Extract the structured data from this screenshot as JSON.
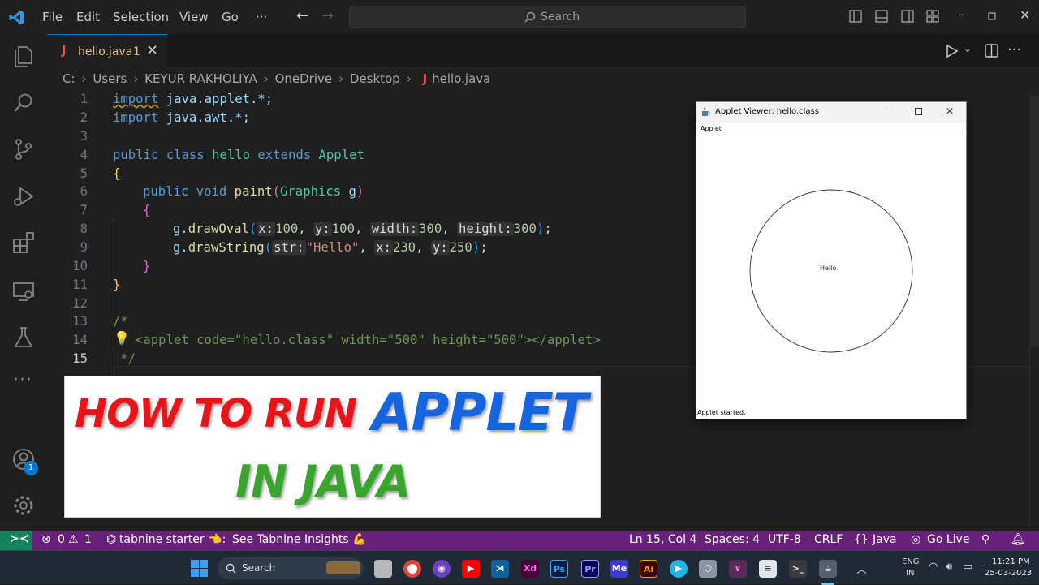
{
  "menu": [
    "File",
    "Edit",
    "Selection",
    "View",
    "Go",
    "···"
  ],
  "search": {
    "label": "Search"
  },
  "tab": {
    "name": "hello.java",
    "problems": "1"
  },
  "breadcrumb": [
    "C:",
    "Users",
    "KEYUR RAKHOLIYA",
    "OneDrive",
    "Desktop",
    "hello.java"
  ],
  "line_numbers": [
    "1",
    "2",
    "3",
    "4",
    "5",
    "6",
    "7",
    "8",
    "9",
    "10",
    "11",
    "12",
    "13",
    "14",
    "15"
  ],
  "code": {
    "l1_kw": "import",
    "l1_rest": " java.applet.*;",
    "l2_kw": "import",
    "l2_rest": " java.awt.*;",
    "l4_public": "public",
    "l4_class": " class",
    "l4_name": " hello",
    "l4_extends": " extends",
    "l4_super": " Applet",
    "l5": "{",
    "l6_public": "public",
    "l6_void": " void",
    "l6_fn": " paint",
    "l6_open": "(",
    "l6_type": "Graphics",
    "l6_var": " g",
    "l6_close": ")",
    "l7": "{",
    "l8_g": "g",
    "l8_dot": ".",
    "l8_fn": "drawOval",
    "l8_open": "(",
    "l8_h1": "x:",
    "l8_v1": "100",
    "l8_c1": ", ",
    "l8_h2": "y:",
    "l8_v2": "100",
    "l8_c2": ", ",
    "l8_h3": "width:",
    "l8_v3": "300",
    "l8_c3": ", ",
    "l8_h4": "height:",
    "l8_v4": "300",
    "l8_close": ")",
    "l8_semi": ";",
    "l9_g": "g",
    "l9_dot": ".",
    "l9_fn": "drawString",
    "l9_open": "(",
    "l9_h1": "str:",
    "l9_v1": "\"Hello\"",
    "l9_c1": ", ",
    "l9_h2": "x:",
    "l9_v2": "230",
    "l9_c2": ", ",
    "l9_h3": "y:",
    "l9_v3": "250",
    "l9_close": ")",
    "l9_semi": ";",
    "l10": "}",
    "l11": "}",
    "l13": "/*",
    "l14": "<applet code=\"hello.class\" width=\"500\" height=\"500\"></applet>",
    "l15": " */"
  },
  "banner": {
    "line1": "HOW TO RUN",
    "line2": "APPLET",
    "line3": "IN JAVA"
  },
  "applet_window": {
    "title": "Applet Viewer: hello.class",
    "menu": "Applet",
    "drawn_text": "Hello",
    "status": "Applet started."
  },
  "statusbar": {
    "errors": "0",
    "warnings": "1",
    "tabnine": "tabnine starter 👈:",
    "insights": "See Tabnine Insights 💪",
    "position": "Ln 15, Col 4",
    "spaces": "Spaces: 4",
    "encoding": "UTF-8",
    "eol": "CRLF",
    "language": "Java",
    "golive": "Go Live"
  },
  "accounts_badge": "1",
  "taskbar": {
    "search_label": "Search",
    "lang": "ENG",
    "region": "IN",
    "time": "11:21 PM",
    "date": "25-03-2023"
  },
  "colors": {
    "statusbar": "#68217a",
    "remote": "#16825d",
    "accent": "#0078d4"
  }
}
